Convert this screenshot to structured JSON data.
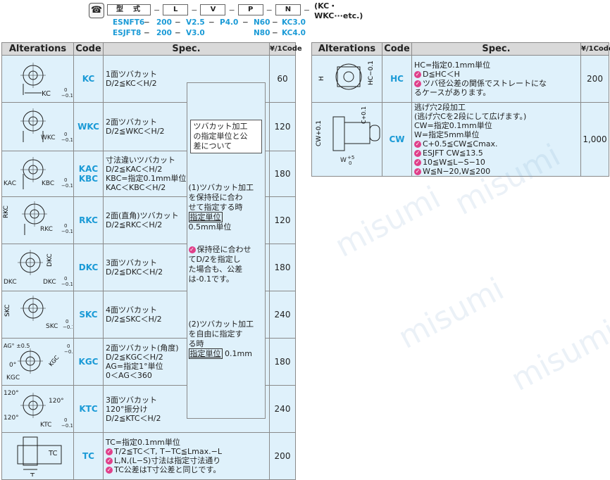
{
  "spec_strip": {
    "icon": "phone-icon",
    "chips": [
      "型　式",
      "L",
      "V",
      "P",
      "N"
    ],
    "tail": "(KC・WKC···etc.)",
    "rows": [
      [
        "ESNFT6",
        "200",
        "V2.5",
        "P4.0",
        "N60",
        "KC3.0"
      ],
      [
        "ESJFT8",
        "200",
        "V3.0",
        "",
        "N80",
        "KC4.0"
      ]
    ]
  },
  "headers": {
    "alterations": "Alterations",
    "code": "Code",
    "spec": "Spec.",
    "price": "¥/1Code"
  },
  "left_rows": [
    {
      "code": "KC",
      "spec": [
        "1面ツバカット",
        "D/2≦KC＜H/2"
      ],
      "price": "60",
      "dim": "KC"
    },
    {
      "code": "WKC",
      "spec": [
        "2面ツバカット",
        "D/2≦WKC＜H/2"
      ],
      "price": "120",
      "dim": "WKC"
    },
    {
      "code": "KAC\nKBC",
      "spec": [
        "寸法違いツバカット",
        "D/2≦KAC＜H/2",
        "KBC=指定0.1mm単位のみ",
        "KAC＜KBC＜H/2"
      ],
      "price": "180",
      "dim": "KBC"
    },
    {
      "code": "RKC",
      "spec": [
        "2面(直角)ツバカット",
        "D/2≦RKC＜H/2"
      ],
      "price": "120",
      "dim": "RKC"
    },
    {
      "code": "DKC",
      "spec": [
        "3面ツバカット",
        "D/2≦DKC＜H/2"
      ],
      "price": "180",
      "dim": "DKC"
    },
    {
      "code": "SKC",
      "spec": [
        "4面ツバカット",
        "D/2≦SKC＜H/2"
      ],
      "price": "240",
      "dim": "SKC"
    },
    {
      "code": "KGC",
      "spec": [
        "2面ツバカット(角度)",
        "D/2≦KGC＜H/2",
        "AG=指定1°単位",
        "0＜AG＜360"
      ],
      "price": "180",
      "dim": "KGC"
    },
    {
      "code": "KTC",
      "spec": [
        "3面ツバカット",
        "120°振分け",
        "D/2≦KTC＜H/2"
      ],
      "price": "240",
      "dim": "KTC"
    },
    {
      "code": "TC",
      "spec": [
        "TC=指定0.1mm単位",
        "T/2≦TC＜T, T−TC≦Lmax.−L",
        "L,N,(L−S)寸法は指定寸法通り",
        "TC公差はT寸公差と同じです。"
      ],
      "price": "200",
      "dim": "TC"
    }
  ],
  "note": {
    "box": [
      "ツバカット加工",
      "の指定単位と公",
      "差について"
    ],
    "p1": [
      "(1)ツバカット加工",
      "を保持径に合わ",
      "せて指定する時"
    ],
    "p1_unit_label": "指定単位",
    "p1_unit": "0.5mm単位",
    "p2": [
      "保持径に合わせ",
      "てD/2を指定し",
      "た場合も、公差",
      "は-0.1です。"
    ],
    "p3": [
      "(2)ツバカット加工",
      "を自由に指定す",
      "る時"
    ],
    "p3_unit_label": "指定単位",
    "p3_unit": "0.1mm"
  },
  "right_rows": [
    {
      "code": "HC",
      "spec": [
        "HC=指定0.1mm単位",
        "D≦HC＜H",
        "ツバ径公差の関係でストレートにな",
        "るケースがあります。"
      ],
      "price": "200"
    },
    {
      "code": "CW",
      "spec": [
        "逃げ穴2段加工",
        "(逃げ穴Cを2段にして広げます。)",
        "CW=指定0.1mm単位",
        "W=指定5mm単位",
        "C+0.5≦CW≦Cmax.",
        "ESJFT CW≦13.5",
        "10≦W≦L−S−10",
        "W≦N−20,W≦200"
      ],
      "price": "1,000"
    }
  ],
  "watermark": "misumi",
  "colors": {
    "header": "#d9d9d9",
    "cell": "#dff1fb",
    "code": "#1a9ad6",
    "pin": "#e0408a"
  }
}
